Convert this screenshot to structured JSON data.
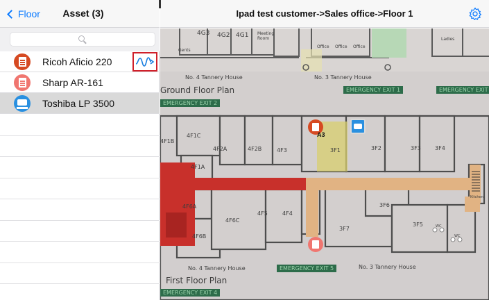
{
  "left_panel": {
    "back_label": "Floor",
    "title": "Asset (3)",
    "search_placeholder": "",
    "assets": [
      {
        "name": "Ricoh Aficio 220",
        "icon": "document-icon",
        "color": "#d64a22"
      },
      {
        "name": "Sharp AR-161",
        "icon": "document-icon",
        "color": "#f07670"
      },
      {
        "name": "Toshiba LP 3500",
        "icon": "printer-icon",
        "color": "#2a90e0",
        "selected": true
      }
    ]
  },
  "right_panel": {
    "breadcrumb_title": "Ipad test customer->Sales office->Floor 1"
  },
  "map": {
    "room_labels": [
      "4G3",
      "4G2",
      "4G1",
      "Meeting Room",
      "Office",
      "Office",
      "Office",
      "Ladies",
      "Gents",
      "4F1C",
      "4F2A",
      "4F2B",
      "4F3",
      "3F1",
      "3F2",
      "3F3",
      "3F4",
      "4F1A",
      "4F1B",
      "4F6A",
      "4F6C",
      "4F5",
      "4F4",
      "3F6",
      "4F6B",
      "3F7",
      "3F5",
      "WC",
      "WC",
      "Kitchen"
    ],
    "building_labels": [
      "No. 4 Tannery House",
      "No. 3 Tannery House",
      "Ground Floor Plan",
      "No. 4 Tannery House",
      "No. 3 Tannery House",
      "First Floor Plan"
    ],
    "exit_labels": [
      "EMERGENCY EXIT 1",
      "EMERGENCY EXIT 2",
      "EMERGENCY EXIT",
      "EMERGENCY EXIT 5",
      "EMERGENCY EXIT 4"
    ],
    "pin_label": "A3"
  },
  "colors": {
    "accent": "#0a7aff",
    "highlight_box": "#d0202a",
    "exit_sign": "#2d6c4a",
    "corridor_red": "#c8302b",
    "corridor_tan": "#e1b383"
  }
}
